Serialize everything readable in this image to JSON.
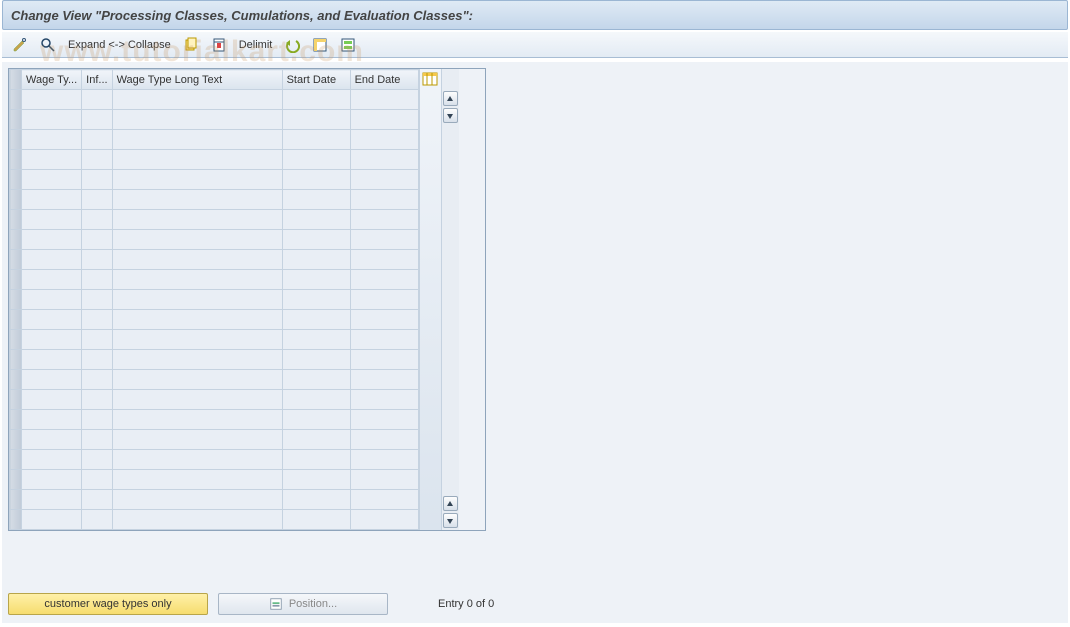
{
  "title": "Change View \"Processing Classes, Cumulations, and Evaluation Classes\":",
  "toolbar": {
    "expand_collapse": "Expand <-> Collapse",
    "delimit": "Delimit"
  },
  "table": {
    "columns": {
      "wage_type": "Wage Ty...",
      "inf": "Inf...",
      "long_text": "Wage Type Long Text",
      "start_date": "Start Date",
      "end_date": "End Date"
    },
    "rows": [
      {
        "wage_type": "",
        "inf": "",
        "long_text": "",
        "start_date": "",
        "end_date": ""
      },
      {
        "wage_type": "",
        "inf": "",
        "long_text": "",
        "start_date": "",
        "end_date": ""
      },
      {
        "wage_type": "",
        "inf": "",
        "long_text": "",
        "start_date": "",
        "end_date": ""
      },
      {
        "wage_type": "",
        "inf": "",
        "long_text": "",
        "start_date": "",
        "end_date": ""
      },
      {
        "wage_type": "",
        "inf": "",
        "long_text": "",
        "start_date": "",
        "end_date": ""
      },
      {
        "wage_type": "",
        "inf": "",
        "long_text": "",
        "start_date": "",
        "end_date": ""
      },
      {
        "wage_type": "",
        "inf": "",
        "long_text": "",
        "start_date": "",
        "end_date": ""
      },
      {
        "wage_type": "",
        "inf": "",
        "long_text": "",
        "start_date": "",
        "end_date": ""
      },
      {
        "wage_type": "",
        "inf": "",
        "long_text": "",
        "start_date": "",
        "end_date": ""
      },
      {
        "wage_type": "",
        "inf": "",
        "long_text": "",
        "start_date": "",
        "end_date": ""
      },
      {
        "wage_type": "",
        "inf": "",
        "long_text": "",
        "start_date": "",
        "end_date": ""
      },
      {
        "wage_type": "",
        "inf": "",
        "long_text": "",
        "start_date": "",
        "end_date": ""
      },
      {
        "wage_type": "",
        "inf": "",
        "long_text": "",
        "start_date": "",
        "end_date": ""
      },
      {
        "wage_type": "",
        "inf": "",
        "long_text": "",
        "start_date": "",
        "end_date": ""
      },
      {
        "wage_type": "",
        "inf": "",
        "long_text": "",
        "start_date": "",
        "end_date": ""
      },
      {
        "wage_type": "",
        "inf": "",
        "long_text": "",
        "start_date": "",
        "end_date": ""
      },
      {
        "wage_type": "",
        "inf": "",
        "long_text": "",
        "start_date": "",
        "end_date": ""
      },
      {
        "wage_type": "",
        "inf": "",
        "long_text": "",
        "start_date": "",
        "end_date": ""
      },
      {
        "wage_type": "",
        "inf": "",
        "long_text": "",
        "start_date": "",
        "end_date": ""
      },
      {
        "wage_type": "",
        "inf": "",
        "long_text": "",
        "start_date": "",
        "end_date": ""
      },
      {
        "wage_type": "",
        "inf": "",
        "long_text": "",
        "start_date": "",
        "end_date": ""
      },
      {
        "wage_type": "",
        "inf": "",
        "long_text": "",
        "start_date": "",
        "end_date": ""
      }
    ]
  },
  "footer": {
    "customer_wage_types": "customer wage types only",
    "position": "Position...",
    "entry_status": "Entry 0 of 0"
  },
  "watermark": "www.tutorialkart.com"
}
